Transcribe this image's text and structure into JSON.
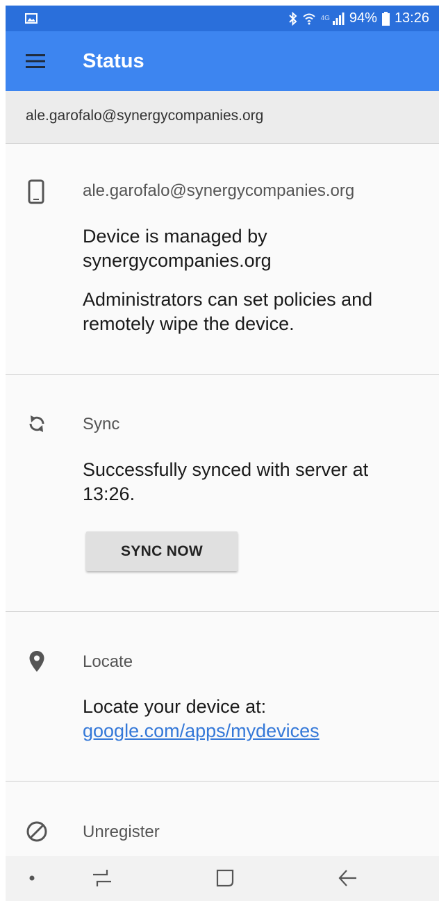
{
  "status_bar": {
    "network": "4G",
    "battery": "94%",
    "time": "13:26"
  },
  "app_bar": {
    "title": "Status"
  },
  "account_header": {
    "email": "ale.garofalo@synergycompanies.org"
  },
  "device_section": {
    "icon": "phone-icon",
    "title": "ale.garofalo@synergycompanies.org",
    "managed_text": "Device is managed by synergycompanies.org",
    "policy_text": "Administrators can set policies and remotely wipe the device."
  },
  "sync_section": {
    "icon": "sync-icon",
    "title": "Sync",
    "status_text": "Successfully synced with server at 13:26.",
    "button_label": "SYNC NOW"
  },
  "locate_section": {
    "icon": "location-pin-icon",
    "title": "Locate",
    "text": "Locate your device at: ",
    "link": "google.com/apps/mydevices"
  },
  "unregister_section": {
    "icon": "block-icon",
    "title": "Unregister"
  },
  "nav_bar": {
    "items": [
      "dot-icon",
      "recent-apps-icon",
      "home-icon",
      "back-icon"
    ]
  },
  "colors": {
    "status_bar": "#2a6fdb",
    "app_bar": "#3d85f0",
    "link": "#3478d8",
    "background": "#fafafa"
  }
}
